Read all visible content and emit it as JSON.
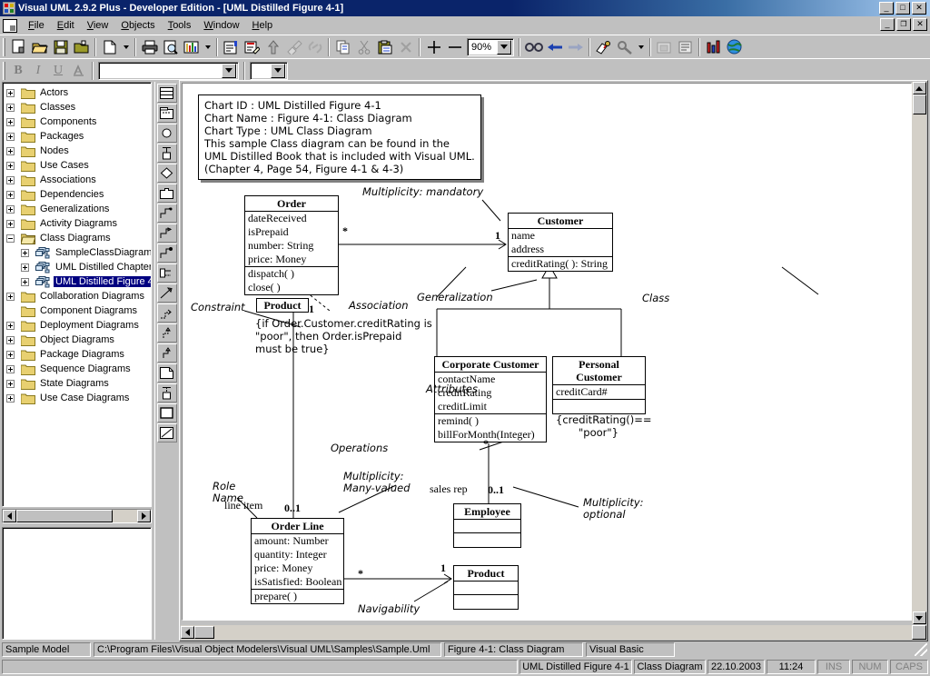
{
  "window": {
    "title": "Visual UML 2.9.2 Plus - Developer Edition - [UML Distilled Figure 4-1]",
    "minimize": "_",
    "maximize": "□",
    "close": "✕",
    "mdi_restore": "▣"
  },
  "menu": [
    {
      "label": "File",
      "accel": "F"
    },
    {
      "label": "Edit",
      "accel": "E"
    },
    {
      "label": "View",
      "accel": "V"
    },
    {
      "label": "Objects",
      "accel": "O"
    },
    {
      "label": "Tools",
      "accel": "T"
    },
    {
      "label": "Window",
      "accel": "W"
    },
    {
      "label": "Help",
      "accel": "H"
    }
  ],
  "toolbar": {
    "zoom_value": "90%",
    "style_combo_value": "",
    "size_combo_value": "",
    "buttons": [
      "new-model-icon",
      "open-folder-icon",
      "save-icon",
      "open-model-icon",
      "new-page-icon",
      "print-icon",
      "print-preview-icon",
      "chart-icon",
      "properties-icon",
      "notes-icon",
      "up-arrow-icon",
      "paint-brush-icon",
      "link-icon",
      "copy-icon",
      "cut-icon",
      "paste-icon",
      "delete-icon",
      "zoom-in-icon",
      "zoom-out-icon",
      "glasses-icon",
      "back-arrow-icon",
      "forward-arrow-icon",
      "generate-code-icon",
      "wrench-icon",
      "report-icon",
      "document-icon",
      "metrics-icon",
      "globe-icon"
    ],
    "format_buttons": [
      "bold-icon",
      "italic-icon",
      "underline-icon",
      "font-color-icon"
    ]
  },
  "palette": {
    "tools": [
      "class-icon",
      "package-component-icon",
      "circle-use-case-icon",
      "node-icon",
      "diamond-icon",
      "folder-icon",
      "transition-icon",
      "start-state-icon",
      "end-state-icon",
      "interface-icon",
      "association-icon",
      "dependency-icon",
      "generalization-dashed-icon",
      "generalization-icon",
      "note-icon",
      "node-instance-icon",
      "rectangle-icon",
      "line-icon"
    ]
  },
  "tree": {
    "items": [
      {
        "label": "Actors",
        "depth": 0,
        "type": "folder",
        "expandable": true,
        "expanded": false,
        "selected": false
      },
      {
        "label": "Classes",
        "depth": 0,
        "type": "folder",
        "expandable": true,
        "expanded": false,
        "selected": false
      },
      {
        "label": "Components",
        "depth": 0,
        "type": "folder",
        "expandable": true,
        "expanded": false,
        "selected": false
      },
      {
        "label": "Packages",
        "depth": 0,
        "type": "folder",
        "expandable": true,
        "expanded": false,
        "selected": false
      },
      {
        "label": "Nodes",
        "depth": 0,
        "type": "folder",
        "expandable": true,
        "expanded": false,
        "selected": false
      },
      {
        "label": "Use Cases",
        "depth": 0,
        "type": "folder",
        "expandable": true,
        "expanded": false,
        "selected": false
      },
      {
        "label": "Associations",
        "depth": 0,
        "type": "folder",
        "expandable": true,
        "expanded": false,
        "selected": false
      },
      {
        "label": "Dependencies",
        "depth": 0,
        "type": "folder",
        "expandable": true,
        "expanded": false,
        "selected": false
      },
      {
        "label": "Generalizations",
        "depth": 0,
        "type": "folder",
        "expandable": true,
        "expanded": false,
        "selected": false
      },
      {
        "label": "Activity Diagrams",
        "depth": 0,
        "type": "folder",
        "expandable": true,
        "expanded": false,
        "selected": false
      },
      {
        "label": "Class Diagrams",
        "depth": 0,
        "type": "folder-open",
        "expandable": true,
        "expanded": true,
        "selected": false
      },
      {
        "label": "SampleClassDiagram1",
        "depth": 1,
        "type": "diagram",
        "expandable": true,
        "expanded": false,
        "selected": false
      },
      {
        "label": "UML Distilled Chapter",
        "depth": 1,
        "type": "diagram",
        "expandable": true,
        "expanded": false,
        "selected": false
      },
      {
        "label": "UML Distilled Figure 4",
        "depth": 1,
        "type": "diagram",
        "expandable": true,
        "expanded": false,
        "selected": true
      },
      {
        "label": "Collaboration Diagrams",
        "depth": 0,
        "type": "folder",
        "expandable": true,
        "expanded": false,
        "selected": false
      },
      {
        "label": "Component Diagrams",
        "depth": 0,
        "type": "folder",
        "expandable": false,
        "expanded": false,
        "selected": false
      },
      {
        "label": "Deployment Diagrams",
        "depth": 0,
        "type": "folder",
        "expandable": true,
        "expanded": false,
        "selected": false
      },
      {
        "label": "Object Diagrams",
        "depth": 0,
        "type": "folder",
        "expandable": true,
        "expanded": false,
        "selected": false
      },
      {
        "label": "Package Diagrams",
        "depth": 0,
        "type": "folder",
        "expandable": true,
        "expanded": false,
        "selected": false
      },
      {
        "label": "Sequence Diagrams",
        "depth": 0,
        "type": "folder",
        "expandable": true,
        "expanded": false,
        "selected": false
      },
      {
        "label": "State Diagrams",
        "depth": 0,
        "type": "folder",
        "expandable": true,
        "expanded": false,
        "selected": false
      },
      {
        "label": "Use Case Diagrams",
        "depth": 0,
        "type": "folder",
        "expandable": true,
        "expanded": false,
        "selected": false
      }
    ]
  },
  "diagram": {
    "note": {
      "lines": [
        "Chart ID : UML Distilled Figure 4-1",
        "Chart Name : Figure 4-1: Class Diagram",
        "Chart Type : UML Class Diagram",
        "This sample Class diagram can be found in the",
        "UML Distilled Book that is included with Visual UML.",
        "(Chapter 4, Page 54, Figure 4-1 & 4-3)"
      ]
    },
    "classes": [
      {
        "name": "Order",
        "attributes": [
          "dateReceived",
          "isPrepaid",
          "number: String",
          "price: Money"
        ],
        "operations": [
          "dispatch( )",
          "close( )"
        ]
      },
      {
        "name": "Customer",
        "attributes": [
          "name",
          "address"
        ],
        "operations": [
          "creditRating( ): String"
        ]
      },
      {
        "name": "Corporate Customer",
        "attributes": [
          "contactName",
          "creditRating",
          "creditLimit"
        ],
        "operations": [
          "remind( )",
          "billForMonth(Integer)"
        ]
      },
      {
        "name": "Personal Customer",
        "attributes": [
          "creditCard#"
        ],
        "operations": []
      },
      {
        "name": "Employee",
        "attributes": [],
        "operations": []
      },
      {
        "name": "Order Line",
        "attributes": [
          "amount: Number",
          "quantity: Integer",
          "price: Money",
          "isSatisfied: Boolean"
        ],
        "operations": [
          "prepare( )"
        ]
      },
      {
        "name": "Product",
        "attributes": [],
        "operations": []
      }
    ],
    "product_stub": "Product",
    "annotations": {
      "multiplicity_mandatory": "Multiplicity: mandatory",
      "association": "Association",
      "generalization": "Generalization",
      "class": "Class",
      "constraint": "Constraint",
      "attributes": "Attributes",
      "operations": "Operations",
      "role_name_line1": "Role",
      "role_name_line2": "Name",
      "multiplicity_many_line1": "Multiplicity:",
      "multiplicity_many_line2": "Many-valued",
      "multiplicity_optional_line1": "Multiplicity:",
      "multiplicity_optional_line2": "optional",
      "navigability": "Navigability"
    },
    "constraint_note": {
      "line1": "{if Order.Customer.creditRating is",
      "line2": "\"poor\", then Order.isPrepaid",
      "line3": "must be true}"
    },
    "personal_constraint": {
      "line1": "{creditRating()==",
      "line2": "\"poor\"}"
    },
    "multiplicities": {
      "order_star": "*",
      "customer_one": "1",
      "product_one": "1",
      "orderline_zeroone": "0..1",
      "employee_zeroone": "0..1",
      "corporate_star": "*",
      "orderline_star": "*",
      "product_one2": "1"
    },
    "roles": {
      "line_item": "line item",
      "sales_rep": "sales rep"
    }
  },
  "statusbar": {
    "model": "Sample Model",
    "path": "C:\\Program Files\\Visual Object Modelers\\Visual UML\\Samples\\Sample.Uml",
    "chart": "Figure 4-1: Class Diagram",
    "language": "Visual Basic",
    "diagram_name": "UML Distilled Figure 4-1",
    "diagram_type": "Class Diagram",
    "date": "22.10.2003",
    "time": "11:24",
    "ins": "INS",
    "num": "NUM",
    "caps": "CAPS"
  }
}
